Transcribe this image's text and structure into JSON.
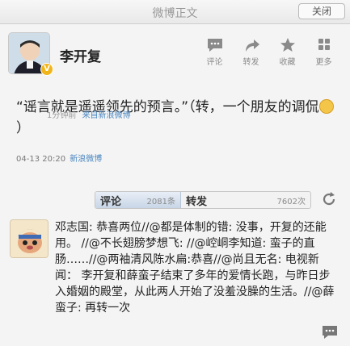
{
  "window": {
    "title": "微博正文",
    "close_label": "关闭"
  },
  "post": {
    "author": "李开复",
    "verified_badge": "V",
    "text": "“谣言就是遥遥领先的预言。”（转，一个朋友的调侃",
    "text_end": "）",
    "time": "04-13 20:20",
    "source": "新浪微博"
  },
  "actions": [
    {
      "label": "评论",
      "icon": "comment-icon"
    },
    {
      "label": "转发",
      "icon": "repost-icon"
    },
    {
      "label": "收藏",
      "icon": "favorite-star-icon"
    },
    {
      "label": "更多",
      "icon": "more-icon"
    }
  ],
  "tabs": {
    "comments": {
      "label": "评论",
      "count": "2081条"
    },
    "reposts": {
      "label": "转发",
      "count": "7602次"
    }
  },
  "comment": {
    "text": "邓志国: 恭喜两位//@都是体制的错: 没事，开复的还能用。 //@不长翅膀梦想飞: //@崆峒李知道: 蛮子的直肠……//@两袖清风陈水扁:恭喜//@尚且无名: 电视新闻： 李开复和薛蛮子结束了多年的爱情长跑，与昨日步入婚姻的殿堂，从此两人开始了没羞没臊的生活。//@薛蛮子: 再转一次",
    "time": "1分钟前",
    "source": "来自新浪微博"
  },
  "colors": {
    "accent": "#4a86c0",
    "icon_gray": "#8a8a8a"
  }
}
